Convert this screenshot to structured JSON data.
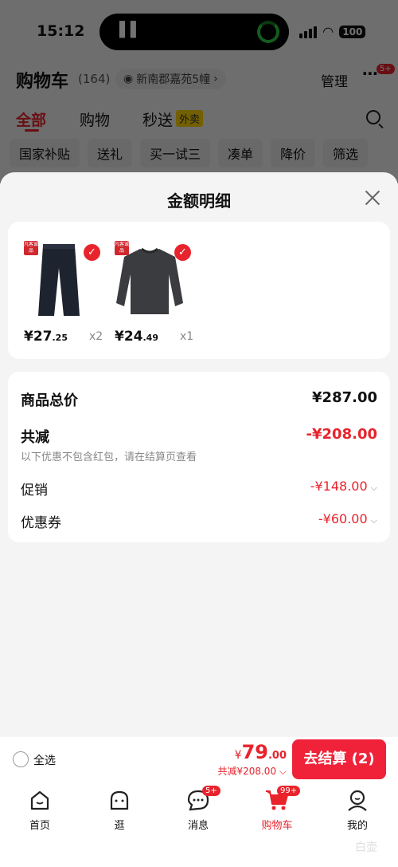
{
  "status_bar": {
    "time": "15:12",
    "battery": "100"
  },
  "cart_header": {
    "title": "购物车",
    "count": "(164)",
    "address": "新南郡嘉苑5幢",
    "manage": "管理",
    "more_badge": "5+"
  },
  "tabs": [
    {
      "label": "全部"
    },
    {
      "label": "购物"
    },
    {
      "label": "秒送",
      "tag": "外卖"
    }
  ],
  "filter_chips": [
    "国家补贴",
    "送礼",
    "买一试三",
    "凑单",
    "降价",
    "筛选"
  ],
  "sheet": {
    "title": "金额明细",
    "items": [
      {
        "tag": "凡客诚品",
        "price_int": "¥27",
        "price_dec": ".25",
        "qty": "x2"
      },
      {
        "tag": "凡客诚品",
        "price_int": "¥24",
        "price_dec": ".49",
        "qty": "x1"
      }
    ],
    "summary": {
      "total_label": "商品总价",
      "total_value": "¥287.00",
      "reduce_label": "共减",
      "reduce_value": "-¥208.00",
      "note": "以下优惠不包含红包，请在结算页查看",
      "promo_label": "促销",
      "promo_value": "-¥148.00",
      "coupon_label": "优惠券",
      "coupon_value": "-¥60.00"
    }
  },
  "checkout": {
    "select_all": "全选",
    "currency": "¥",
    "price_int": "79",
    "price_dec": ".00",
    "discount": "共减¥208.00",
    "button": "去结算 (2)"
  },
  "tabbar": {
    "items": [
      {
        "label": "首页"
      },
      {
        "label": "逛"
      },
      {
        "label": "消息",
        "badge": "5+"
      },
      {
        "label": "购物车",
        "badge": "99+"
      },
      {
        "label": "我的"
      }
    ]
  },
  "watermark": "白壶",
  "colors": {
    "accent": "#e8232c",
    "button": "#f0223a"
  }
}
